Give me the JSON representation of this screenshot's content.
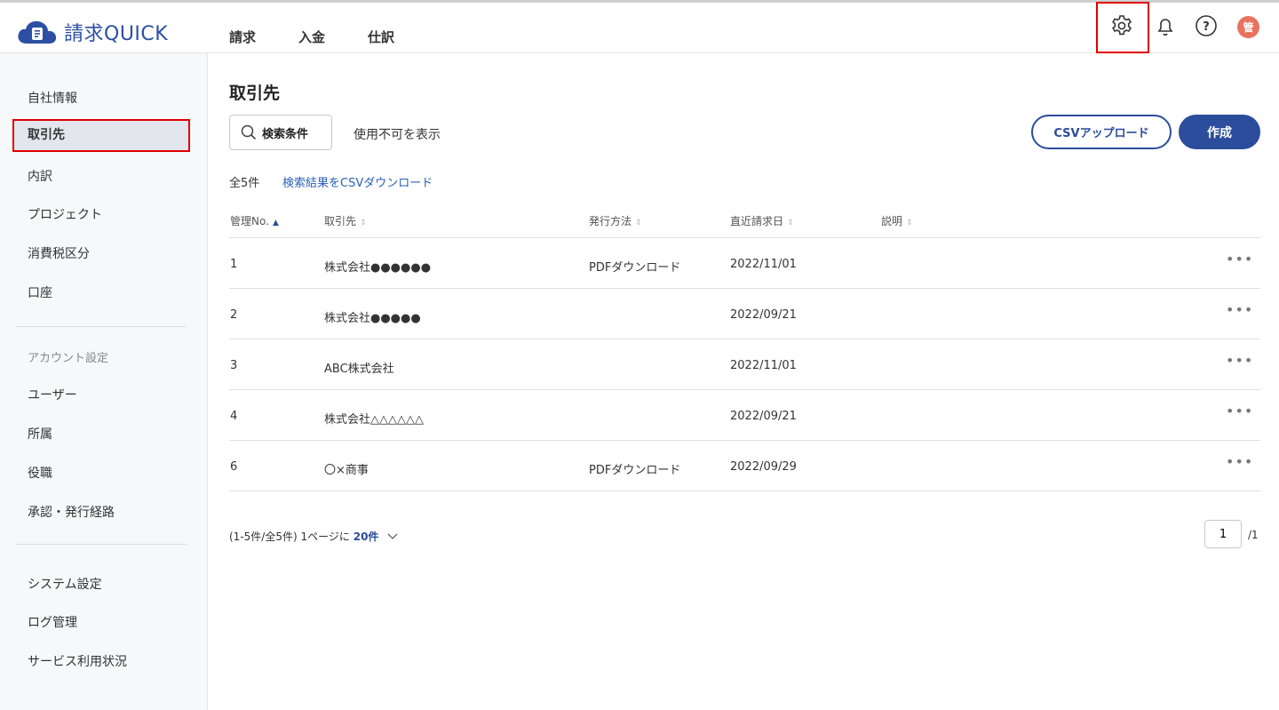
{
  "app": {
    "name": "請求QUICK"
  },
  "topnav": {
    "items": [
      "請求",
      "入金",
      "仕訳"
    ]
  },
  "header": {
    "avatar_text": "管",
    "icons": [
      "gear-icon",
      "bell-icon",
      "help-icon"
    ]
  },
  "sidebar": {
    "group1": [
      "自社情報",
      "取引先",
      "内訳",
      "プロジェクト",
      "消費税区分",
      "口座"
    ],
    "active": "取引先",
    "account_heading": "アカウント設定",
    "group2": [
      "ユーザー",
      "所属",
      "役職",
      "承認・発行経路"
    ],
    "group3": [
      "システム設定",
      "ログ管理",
      "サービス利用状況"
    ]
  },
  "main": {
    "title": "取引先",
    "search_label": "検索条件",
    "show_disabled": "使用不可を表示",
    "csv_upload": "CSVアップロード",
    "create": "作成",
    "count": "全5件",
    "download_link": "検索結果をCSVダウンロード"
  },
  "table": {
    "columns": [
      "管理No.",
      "取引先",
      "発行方法",
      "直近請求日",
      "説明"
    ],
    "rows": [
      {
        "no": "1",
        "name": "株式会社●●●●●●",
        "method": "PDFダウンロード",
        "date": "2022/11/01",
        "desc": ""
      },
      {
        "no": "2",
        "name": "株式会社●●●●●",
        "method": "",
        "date": "2022/09/21",
        "desc": ""
      },
      {
        "no": "3",
        "name": "ABC株式会社",
        "method": "",
        "date": "2022/11/01",
        "desc": ""
      },
      {
        "no": "4",
        "name": "株式会社△△△△△△",
        "method": "",
        "date": "2022/09/21",
        "desc": ""
      },
      {
        "no": "6",
        "name": "〇×商事",
        "method": "PDFダウンロード",
        "date": "2022/09/29",
        "desc": ""
      }
    ],
    "more_label": "•••"
  },
  "pager": {
    "range": "(1-5件/全5件)",
    "per_page_label": "1ページに",
    "per_page_value": "20件",
    "current_page": "1",
    "total_pages": "/1"
  },
  "colors": {
    "accent": "#2b4d9b",
    "highlight": "#e00000",
    "avatar": "#e8735f"
  }
}
